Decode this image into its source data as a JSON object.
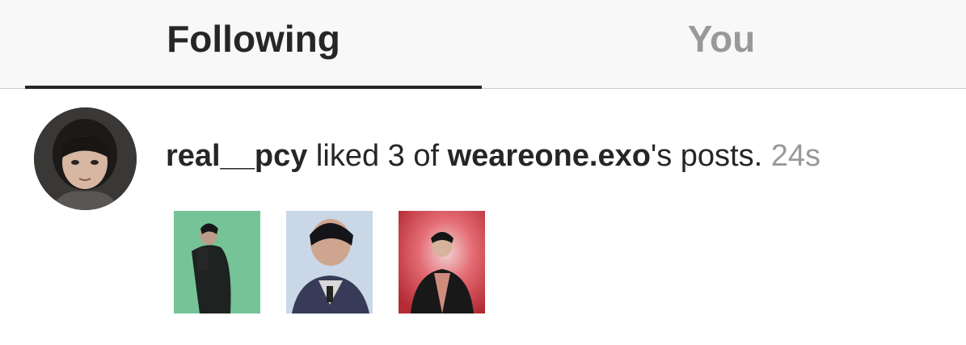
{
  "tabs": {
    "following_label": "Following",
    "you_label": "You",
    "active": "following"
  },
  "activity": {
    "avatar_icon": "user-avatar-photo",
    "username": "real__pcy",
    "action_text": " liked 3 of ",
    "post_owner": "weareone.exo",
    "suffix_text": "'s posts. ",
    "timestamp": "24s",
    "thumbnails": [
      {
        "icon": "post-thumbnail-green-photo",
        "bg": "#7cc79a"
      },
      {
        "icon": "post-thumbnail-blue-photo",
        "bg": "#c6d6e6"
      },
      {
        "icon": "post-thumbnail-red-photo",
        "bg": "#c2383c"
      }
    ]
  },
  "colors": {
    "active_tab_text": "#262626",
    "inactive_tab_text": "#999999",
    "timestamp": "#999999"
  }
}
